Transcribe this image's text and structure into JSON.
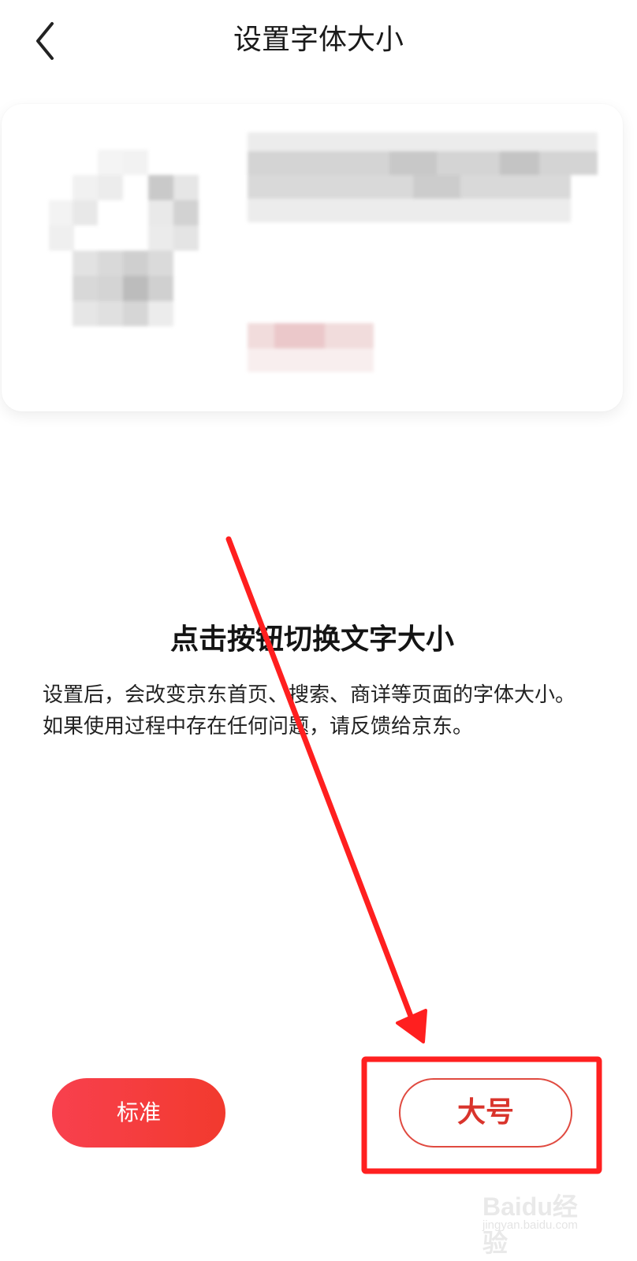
{
  "header": {
    "title": "设置字体大小",
    "back_icon": "chevron-left-icon"
  },
  "instruction": {
    "title": "点击按钮切换文字大小",
    "description": "设置后，会改变京东首页、搜索、商详等页面的字体大小。如果使用过程中存在任何问题，请反馈给京东。"
  },
  "buttons": {
    "standard_label": "标准",
    "large_label": "大号"
  },
  "watermark": {
    "brand": "Baidu经验",
    "sub": "jingyan.baidu.com"
  },
  "colors": {
    "accent": "#f23a2e",
    "accent_light": "#f8404e",
    "annotation": "#ff2020",
    "title": "#1a1a1a"
  }
}
